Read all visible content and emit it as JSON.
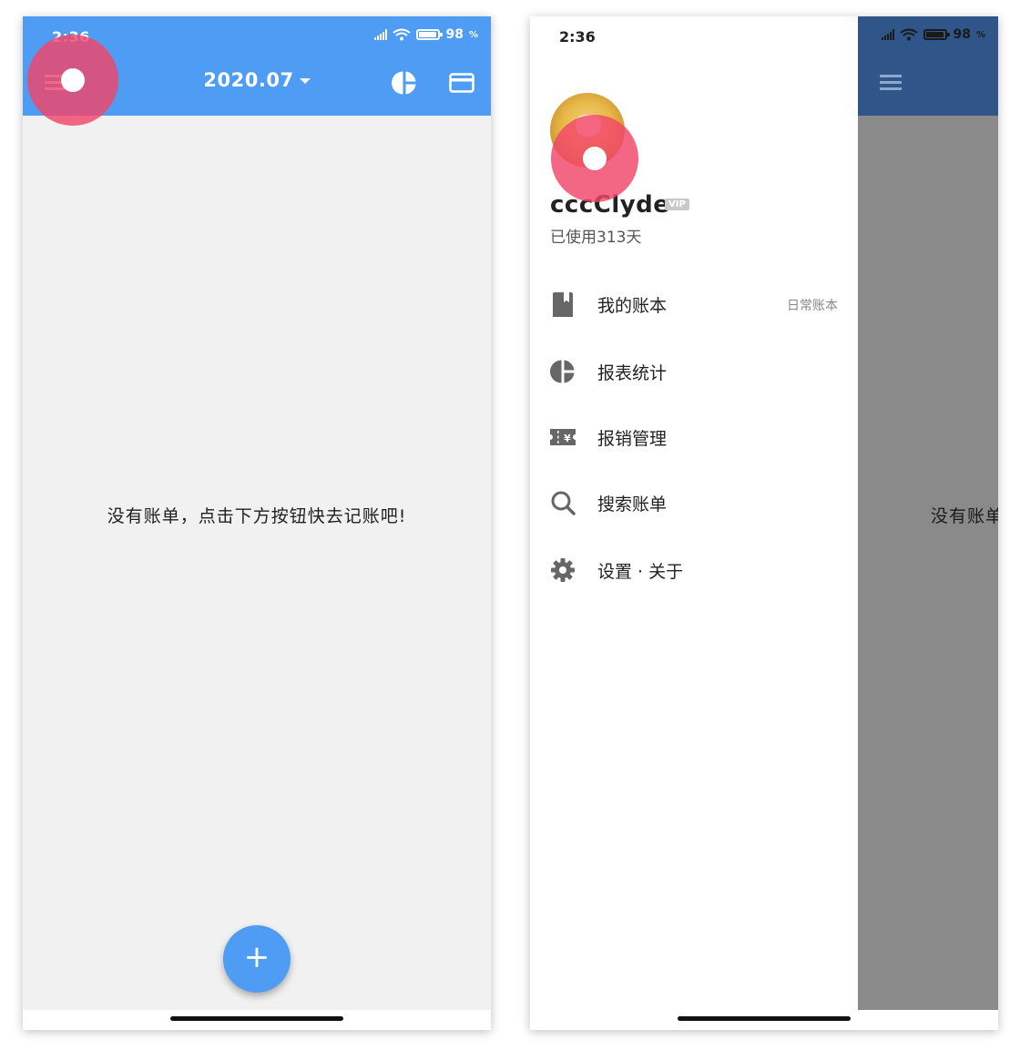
{
  "left_screen": {
    "status": {
      "time": "2:36",
      "battery": "98"
    },
    "app_bar": {
      "month": "2020.07"
    },
    "empty_message": "没有账单，点击下方按钮快去记账吧!",
    "fab_label": "+"
  },
  "right_screen": {
    "status": {
      "time": "2:36",
      "battery": "98"
    },
    "background_message": "没有账单",
    "drawer": {
      "username": "cccClyde",
      "vip_badge": "VIP",
      "days_used": "已使用313天",
      "items": [
        {
          "label": "我的账本",
          "icon": "book-icon",
          "extra": "日常账本"
        },
        {
          "label": "报表统计",
          "icon": "pie-chart-icon",
          "extra": ""
        },
        {
          "label": "报销管理",
          "icon": "reimburse-ticket-icon",
          "extra": ""
        },
        {
          "label": "搜索账单",
          "icon": "search-icon",
          "extra": ""
        },
        {
          "label": "设置 · 关于",
          "icon": "gear-icon",
          "extra": ""
        }
      ]
    }
  },
  "colors": {
    "accent": "#4f9cf5",
    "touch_indicator": "#f24669",
    "scrim_appbar": "#2f5589",
    "scrim": "#8a8a8a"
  }
}
